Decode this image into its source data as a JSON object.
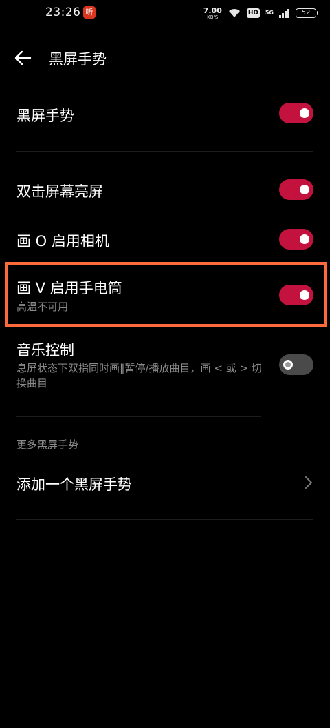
{
  "status_bar": {
    "time": "23:26",
    "app_badge": "听",
    "speed_value": "7.00",
    "speed_unit": "KB/S",
    "hd": "HD",
    "network": "5G",
    "battery": "52"
  },
  "header": {
    "title": "黑屏手势"
  },
  "settings": {
    "master": {
      "title": "黑屏手势",
      "enabled": true
    },
    "double_tap": {
      "title": "双击屏幕亮屏",
      "enabled": true
    },
    "draw_o": {
      "title": "画 O 启用相机",
      "enabled": true
    },
    "draw_v": {
      "title": "画 V 启用手电筒",
      "subtitle": "高温不可用",
      "enabled": true
    },
    "music": {
      "title": "音乐控制",
      "subtitle": "息屏状态下双指同时画‖暂停/播放曲目，画 < 或 > 切换曲目",
      "enabled": false
    }
  },
  "more_section": {
    "label": "更多黑屏手势",
    "add_item": "添加一个黑屏手势"
  },
  "colors": {
    "toggle_on": "#c4123f",
    "toggle_off": "#4a4a4a",
    "highlight": "#ff6a3c",
    "secondary_text": "#8a8a8a"
  }
}
